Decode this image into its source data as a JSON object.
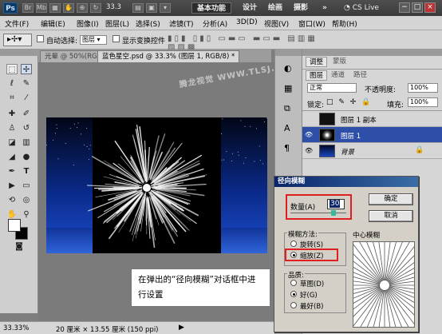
{
  "appbar": {
    "logo": "Ps",
    "zoom": "33.3",
    "workspaces": [
      "基本功能",
      "设计",
      "绘画",
      "摄影"
    ],
    "more": "»",
    "cslive": "CS Live",
    "window_buttons": [
      "−",
      "□",
      "×"
    ]
  },
  "menu": [
    "文件(F)",
    "编辑(E)",
    "图像(I)",
    "图层(L)",
    "选择(S)",
    "滤镜(T)",
    "分析(A)",
    "3D(D)",
    "视图(V)",
    "窗口(W)",
    "帮助(H)"
  ],
  "options": {
    "auto_select_label": "自动选择:",
    "auto_select_value": "图层",
    "show_transform_label": "显示变换控件"
  },
  "tabs": [
    {
      "label": "光晕 @ 50%(RG",
      "active": false
    },
    {
      "label": "蓝色星空.psd @ 33.3% (图层 1, RGB/8) *",
      "active": true
    }
  ],
  "watermark": "腾龙视觉 WWW.TLSJ.COM",
  "status": {
    "zoom": "33.33%",
    "doc": "20 厘米 × 13.55 厘米 (150 ppi)"
  },
  "layers_panel": {
    "top_tabs": [
      "调整",
      "蒙版"
    ],
    "tabs": [
      "图层",
      "通道",
      "路径"
    ],
    "blend_mode": "正常",
    "opacity_label": "不透明度:",
    "opacity_value": "100%",
    "lock_label": "锁定:",
    "fill_label": "填充:",
    "fill_value": "100%",
    "layers": [
      {
        "name": "图层 1 副本",
        "visible": false,
        "selected": false
      },
      {
        "name": "图层 1",
        "visible": true,
        "selected": true
      },
      {
        "name": "背景",
        "visible": true,
        "selected": false,
        "locked": true
      }
    ]
  },
  "dialog": {
    "title": "径向模糊",
    "amount_label": "数量(A)",
    "amount_value": "30",
    "ok": "确定",
    "cancel": "取消",
    "method_label": "模糊方法:",
    "method_spin": "旋转(S)",
    "method_zoom": "缩放(Z)",
    "quality_label": "品质:",
    "quality_draft": "草图(D)",
    "quality_good": "好(G)",
    "quality_best": "最好(B)",
    "center_label": "中心模糊"
  },
  "callout": "在弹出的“径向模糊”对话框中进行设置"
}
